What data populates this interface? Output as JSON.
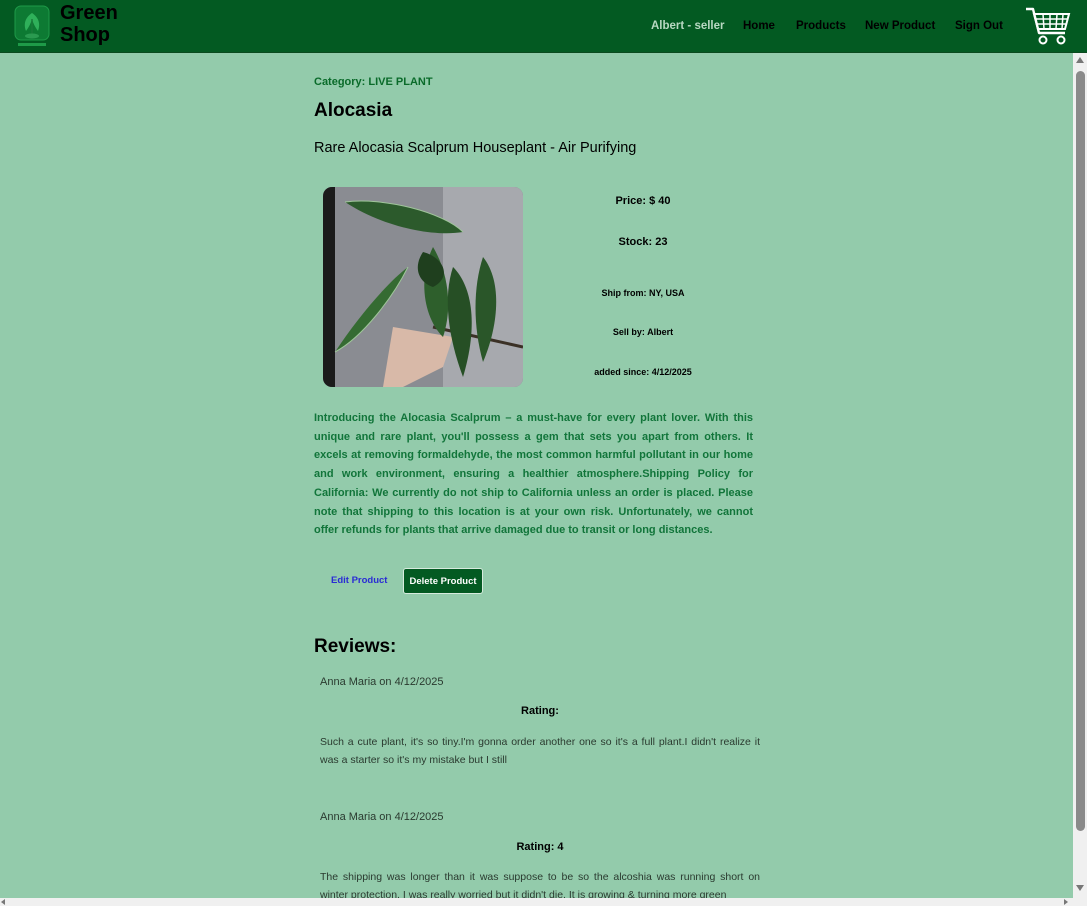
{
  "header": {
    "brand": "Green\nShop",
    "logo_icon": "green-shop-logo",
    "user_label": "Albert - seller",
    "nav": {
      "home": "Home",
      "products": "Products",
      "new_product": "New Product",
      "sign_out": "Sign Out"
    },
    "cart_icon": "shopping-cart-icon"
  },
  "product": {
    "category": "Category: LIVE PLANT",
    "name": "Alocasia",
    "subtitle": "Rare Alocasia Scalprum Houseplant - Air Purifying",
    "price": "Price: $ 40",
    "stock": "Stock: 23",
    "ship_from": "Ship from: NY, USA",
    "seller": "Sell by: Albert",
    "added": "added since: 4/12/2025",
    "description": "Introducing the Alocasia Scalprum – a must-have for every plant lover. With this unique and rare plant, you'll possess a gem that sets you apart from others. It excels at removing formaldehyde, the most common harmful pollutant in our home and work environment, ensuring a healthier atmosphere.Shipping Policy for California: We currently do not ship to California unless an order is placed. Please note that shipping to this location is at your own risk. Unfortunately, we cannot offer refunds for plants that arrive damaged due to transit or long distances."
  },
  "actions": {
    "edit": "Edit Product",
    "delete": "Delete Product"
  },
  "reviews": {
    "heading": "Reviews:",
    "items": [
      {
        "author": "Anna Maria on 4/12/2025",
        "rating": "Rating:",
        "text": "Such a cute plant, it's so tiny.I'm gonna order another one so it's a full plant.I didn't realize it was a starter so it's my mistake but I still"
      },
      {
        "author": "Anna Maria on 4/12/2025",
        "rating": "Rating: 4",
        "text": "The shipping was longer than it was suppose to be so the alcoshia was running short on winter protection. I was really worried but it didn't die. It is growing & turning more green"
      }
    ]
  },
  "colors": {
    "page_bg": "#93cbab",
    "nav_bg": "#035a22",
    "description_text": "#11753a",
    "edit_link": "#2a2bd4"
  }
}
